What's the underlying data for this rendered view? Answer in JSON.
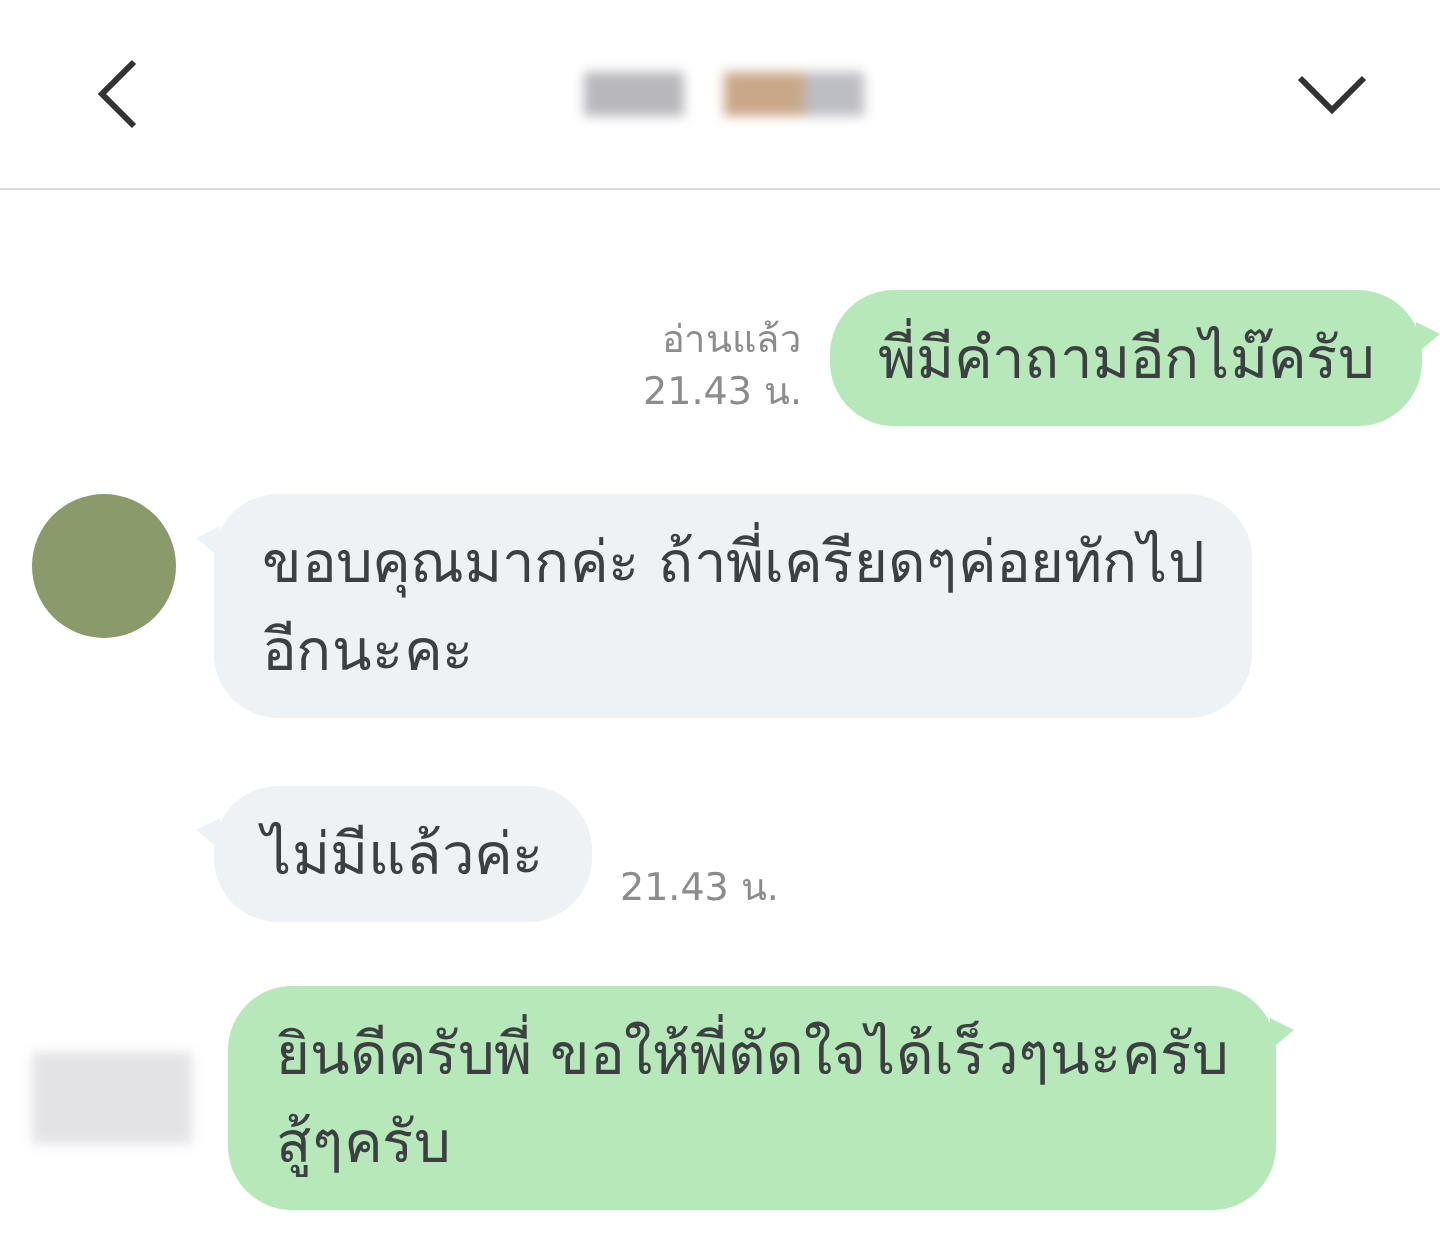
{
  "header": {
    "title_blurred": true
  },
  "messages": [
    {
      "kind": "sent",
      "text": "พี่มีคำถามอีกไม๊ครับ",
      "read_label": "อ่านแล้ว",
      "time": "21.43 น.",
      "avatar": false
    },
    {
      "kind": "received",
      "text": "ขอบคุณมากค่ะ ถ้าพี่เครียดๆค่อยทักไป\nอีกนะคะ",
      "avatar": true
    },
    {
      "kind": "received",
      "text": "ไม่มีแล้วค่ะ",
      "time": "21.43 น.",
      "avatar": false
    },
    {
      "kind": "sent",
      "text": "ยินดีครับพี่ ขอให้พี่ตัดใจได้เร็วๆนะครับ\nสู้ๆครับ",
      "meta_blurred": true,
      "avatar": false
    }
  ]
}
